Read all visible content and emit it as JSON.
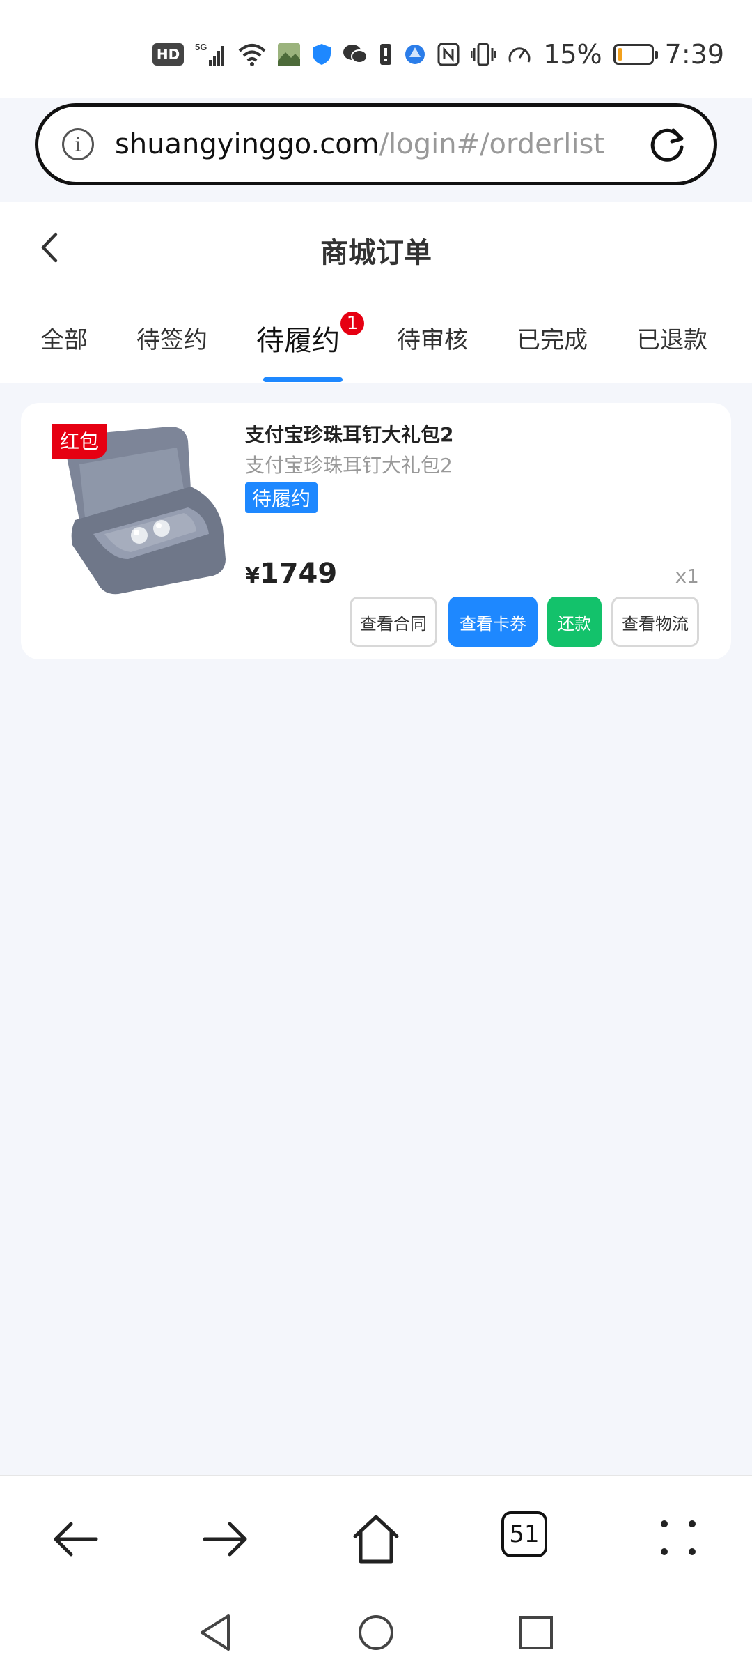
{
  "status_bar": {
    "hd": "HD",
    "network": "5G",
    "battery_percent": "15%",
    "battery_level": 0.15,
    "time": "7:39",
    "icons": [
      "hd-icon",
      "signal-5g-icon",
      "wifi-icon",
      "photo-icon",
      "shield-icon",
      "wechat-icon",
      "sim-icon",
      "browser-icon",
      "nfc-icon",
      "vibrate-icon",
      "speed-icon",
      "battery-icon"
    ]
  },
  "url_bar": {
    "domain": "shuangyinggo.com",
    "path": "/login#/orderlist"
  },
  "header": {
    "title": "商城订单"
  },
  "tabs": [
    {
      "label": "全部"
    },
    {
      "label": "待签约"
    },
    {
      "label": "待履约",
      "badge": "1",
      "active": true
    },
    {
      "label": "待审核"
    },
    {
      "label": "已完成"
    },
    {
      "label": "已退款"
    }
  ],
  "order": {
    "tag": "红包",
    "name": "支付宝珍珠耳钉大礼包2",
    "subtitle": "支付宝珍珠耳钉大礼包2",
    "status": "待履约",
    "currency": "¥",
    "price": "1749",
    "quantity": "x1",
    "buttons": {
      "contract": "查看合同",
      "voucher": "查看卡券",
      "repay": "还款",
      "logistics": "查看物流"
    },
    "colors": {
      "blue": "#1e88ff",
      "green": "#13c26b",
      "red": "#e60012"
    }
  },
  "browser_nav": {
    "tab_count": "51",
    "icons": [
      "back-arrow-icon",
      "forward-arrow-icon",
      "home-icon",
      "tabs-icon",
      "menu-dots-icon"
    ]
  }
}
